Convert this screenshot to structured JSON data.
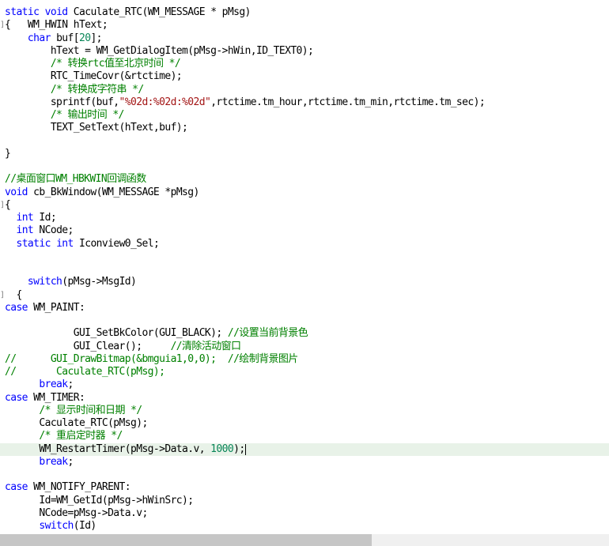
{
  "code_lines": [
    {
      "text": "static void Caculate_RTC(WM_MESSAGE * pMsg)",
      "tokens": [
        {
          "t": "static",
          "c": "kw"
        },
        {
          "t": " "
        },
        {
          "t": "void",
          "c": "kw"
        },
        {
          "t": " Caculate_RTC(WM_MESSAGE * pMsg)"
        }
      ]
    },
    {
      "text": "{   WM_HWIN hText;",
      "fold": "]",
      "tokens": [
        {
          "t": "{   WM_HWIN hText;"
        }
      ]
    },
    {
      "text": "    char buf[20];",
      "tokens": [
        {
          "t": "    "
        },
        {
          "t": "char",
          "c": "kw"
        },
        {
          "t": " buf["
        },
        {
          "t": "20",
          "c": "num"
        },
        {
          "t": "];"
        }
      ]
    },
    {
      "text": "        hText = WM_GetDialogItem(pMsg->hWin,ID_TEXT0);",
      "tokens": [
        {
          "t": "        hText = WM_GetDialogItem(pMsg->hWin,ID_TEXT0);"
        }
      ]
    },
    {
      "text": "        /* 转换rtc值至北京时间 */",
      "tokens": [
        {
          "t": "        "
        },
        {
          "t": "/* 转换rtc值至北京时间 */",
          "c": "cm"
        }
      ]
    },
    {
      "text": "        RTC_TimeCovr(&rtctime);",
      "tokens": [
        {
          "t": "        RTC_TimeCovr(&rtctime);"
        }
      ]
    },
    {
      "text": "        /* 转换成字符串 */",
      "tokens": [
        {
          "t": "        "
        },
        {
          "t": "/* 转换成字符串 */",
          "c": "cm"
        }
      ]
    },
    {
      "text": "        sprintf(buf,\"%02d:%02d:%02d\",rtctime.tm_hour,rtctime.tm_min,rtctime.tm_sec);",
      "tokens": [
        {
          "t": "        sprintf(buf,"
        },
        {
          "t": "\"%02d:%02d:%02d\"",
          "c": "str"
        },
        {
          "t": ",rtctime.tm_hour,rtctime.tm_min,rtctime.tm_sec);"
        }
      ]
    },
    {
      "text": "        /* 输出时间 */",
      "tokens": [
        {
          "t": "        "
        },
        {
          "t": "/* 输出时间 */",
          "c": "cm"
        }
      ]
    },
    {
      "text": "        TEXT_SetText(hText,buf);",
      "tokens": [
        {
          "t": "        TEXT_SetText(hText,buf);"
        }
      ]
    },
    {
      "text": "",
      "tokens": []
    },
    {
      "text": "}",
      "tokens": [
        {
          "t": "}"
        }
      ]
    },
    {
      "text": "",
      "tokens": []
    },
    {
      "text": "//桌面窗口WM_HBKWIN回调函数",
      "tokens": [
        {
          "t": "//桌面窗口WM_HBKWIN回调函数",
          "c": "cm"
        }
      ]
    },
    {
      "text": "void cb_BkWindow(WM_MESSAGE *pMsg)",
      "tokens": [
        {
          "t": "void",
          "c": "kw"
        },
        {
          "t": " cb_BkWindow(WM_MESSAGE *pMsg)"
        }
      ]
    },
    {
      "text": "{",
      "fold": "]",
      "tokens": [
        {
          "t": "{"
        }
      ]
    },
    {
      "text": "  int Id;",
      "tokens": [
        {
          "t": "  "
        },
        {
          "t": "int",
          "c": "kw"
        },
        {
          "t": " Id;"
        }
      ]
    },
    {
      "text": "  int NCode;",
      "tokens": [
        {
          "t": "  "
        },
        {
          "t": "int",
          "c": "kw"
        },
        {
          "t": " NCode;"
        }
      ]
    },
    {
      "text": "  static int Iconview0_Sel;",
      "tokens": [
        {
          "t": "  "
        },
        {
          "t": "static",
          "c": "kw"
        },
        {
          "t": " "
        },
        {
          "t": "int",
          "c": "kw"
        },
        {
          "t": " Iconview0_Sel;"
        }
      ]
    },
    {
      "text": "",
      "tokens": []
    },
    {
      "text": "",
      "tokens": []
    },
    {
      "text": "    switch(pMsg->MsgId)",
      "tokens": [
        {
          "t": "    "
        },
        {
          "t": "switch",
          "c": "kw"
        },
        {
          "t": "(pMsg->MsgId)"
        }
      ]
    },
    {
      "text": "  {",
      "fold": "]",
      "tokens": [
        {
          "t": "  {"
        }
      ]
    },
    {
      "text": "case WM_PAINT:",
      "tokens": [
        {
          "t": "case",
          "c": "kw"
        },
        {
          "t": " WM_PAINT:"
        }
      ]
    },
    {
      "text": "",
      "tokens": []
    },
    {
      "text": "            GUI_SetBkColor(GUI_BLACK); //设置当前背景色",
      "tokens": [
        {
          "t": "            GUI_SetBkColor(GUI_BLACK); "
        },
        {
          "t": "//设置当前背景色",
          "c": "cm"
        }
      ]
    },
    {
      "text": "            GUI_Clear();     //清除活动窗口",
      "tokens": [
        {
          "t": "            GUI_Clear();     "
        },
        {
          "t": "//清除活动窗口",
          "c": "cm"
        }
      ]
    },
    {
      "text": "//      GUI_DrawBitmap(&bmguia1,0,0);  //绘制背景图片",
      "tokens": [
        {
          "t": "//      GUI_DrawBitmap(&bmguia1,0,0);  //绘制背景图片",
          "c": "cm"
        }
      ]
    },
    {
      "text": "//       Caculate_RTC(pMsg);",
      "tokens": [
        {
          "t": "//       Caculate_RTC(pMsg);",
          "c": "cm"
        }
      ]
    },
    {
      "text": "      break;",
      "tokens": [
        {
          "t": "      "
        },
        {
          "t": "break",
          "c": "kw"
        },
        {
          "t": ";"
        }
      ]
    },
    {
      "text": "case WM_TIMER:",
      "tokens": [
        {
          "t": "case",
          "c": "kw"
        },
        {
          "t": " WM_TIMER:"
        }
      ]
    },
    {
      "text": "      /* 显示时间和日期 */",
      "tokens": [
        {
          "t": "      "
        },
        {
          "t": "/* 显示时间和日期 */",
          "c": "cm"
        }
      ]
    },
    {
      "text": "      Caculate_RTC(pMsg);",
      "tokens": [
        {
          "t": "      Caculate_RTC(pMsg);"
        }
      ]
    },
    {
      "text": "      /* 重启定时器 */",
      "tokens": [
        {
          "t": "      "
        },
        {
          "t": "/* 重启定时器 */",
          "c": "cm"
        }
      ]
    },
    {
      "text": "      WM_RestartTimer(pMsg->Data.v, 1000);",
      "current": true,
      "tokens": [
        {
          "t": "      WM_RestartTimer(pMsg->Data.v, "
        },
        {
          "t": "1000",
          "c": "num"
        },
        {
          "t": ");"
        }
      ]
    },
    {
      "text": "      break;",
      "tokens": [
        {
          "t": "      "
        },
        {
          "t": "break",
          "c": "kw"
        },
        {
          "t": ";"
        }
      ]
    },
    {
      "text": "",
      "tokens": []
    },
    {
      "text": "case WM_NOTIFY_PARENT:",
      "tokens": [
        {
          "t": "case",
          "c": "kw"
        },
        {
          "t": " WM_NOTIFY_PARENT:"
        }
      ]
    },
    {
      "text": "      Id=WM_GetId(pMsg->hWinSrc);",
      "tokens": [
        {
          "t": "      Id=WM_GetId(pMsg->hWinSrc);"
        }
      ]
    },
    {
      "text": "      NCode=pMsg->Data.v;",
      "tokens": [
        {
          "t": "      NCode=pMsg->Data.v;"
        }
      ]
    },
    {
      "text": "      switch(Id)",
      "tokens": [
        {
          "t": "      "
        },
        {
          "t": "switch",
          "c": "kw"
        },
        {
          "t": "(Id)"
        }
      ]
    }
  ],
  "colors": {
    "keyword": "#0000ff",
    "comment": "#008000",
    "string": "#a31515",
    "number": "#098658",
    "current_line": "#e8f2e8"
  }
}
